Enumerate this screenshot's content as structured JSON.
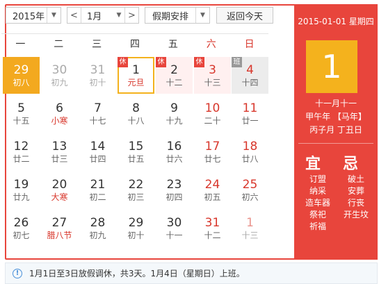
{
  "toolbar": {
    "year": "2015年",
    "month": "1月",
    "prev_month": "<",
    "next_month": ">",
    "holiday": "假期安排",
    "today": "返回今天"
  },
  "weekdays": [
    "一",
    "二",
    "三",
    "四",
    "五",
    "六",
    "日"
  ],
  "weeks": [
    [
      {
        "d": "29",
        "l": "初八",
        "state": "selected"
      },
      {
        "d": "30",
        "l": "初九",
        "state": "other"
      },
      {
        "d": "31",
        "l": "初十",
        "state": "other"
      },
      {
        "d": "1",
        "l": "元旦",
        "state": "today",
        "badge": "休",
        "fest": true
      },
      {
        "d": "2",
        "l": "十二",
        "state": "holiday",
        "badge": "休"
      },
      {
        "d": "3",
        "l": "十三",
        "state": "holiday",
        "badge": "休"
      },
      {
        "d": "4",
        "l": "十四",
        "state": "workday",
        "badge": "班"
      }
    ],
    [
      {
        "d": "5",
        "l": "十五"
      },
      {
        "d": "6",
        "l": "小寒",
        "fest": true
      },
      {
        "d": "7",
        "l": "十七"
      },
      {
        "d": "8",
        "l": "十八"
      },
      {
        "d": "9",
        "l": "十九"
      },
      {
        "d": "10",
        "l": "二十"
      },
      {
        "d": "11",
        "l": "廿一"
      }
    ],
    [
      {
        "d": "12",
        "l": "廿二"
      },
      {
        "d": "13",
        "l": "廿三"
      },
      {
        "d": "14",
        "l": "廿四"
      },
      {
        "d": "15",
        "l": "廿五"
      },
      {
        "d": "16",
        "l": "廿六"
      },
      {
        "d": "17",
        "l": "廿七"
      },
      {
        "d": "18",
        "l": "廿八"
      }
    ],
    [
      {
        "d": "19",
        "l": "廿九"
      },
      {
        "d": "20",
        "l": "大寒",
        "fest": true
      },
      {
        "d": "21",
        "l": "初二"
      },
      {
        "d": "22",
        "l": "初三"
      },
      {
        "d": "23",
        "l": "初四"
      },
      {
        "d": "24",
        "l": "初五"
      },
      {
        "d": "25",
        "l": "初六"
      }
    ],
    [
      {
        "d": "26",
        "l": "初七"
      },
      {
        "d": "27",
        "l": "腊八节",
        "fest": true
      },
      {
        "d": "28",
        "l": "初九"
      },
      {
        "d": "29",
        "l": "初十"
      },
      {
        "d": "30",
        "l": "十一"
      },
      {
        "d": "31",
        "l": "十二"
      },
      {
        "d": "1",
        "l": "十三",
        "state": "other"
      }
    ]
  ],
  "side": {
    "date": "2015-01-01 星期四",
    "day": "1",
    "lunar1": "十一月十一",
    "lunar2": "甲午年 【马年】",
    "lunar3": "丙子月 丁丑日",
    "yi_title": "宜",
    "ji_title": "忌",
    "yi": [
      "订盟",
      "纳采",
      "造车器",
      "祭祀",
      "祈福"
    ],
    "ji": [
      "破土",
      "安葬",
      "行丧",
      "开生坟"
    ]
  },
  "notice": {
    "icon": "info-icon",
    "text": "1月1日至3日放假调休，共3天。1月4日（星期日）上班。"
  },
  "colors": {
    "accent": "#e8453c",
    "highlight": "#f4b21d"
  }
}
